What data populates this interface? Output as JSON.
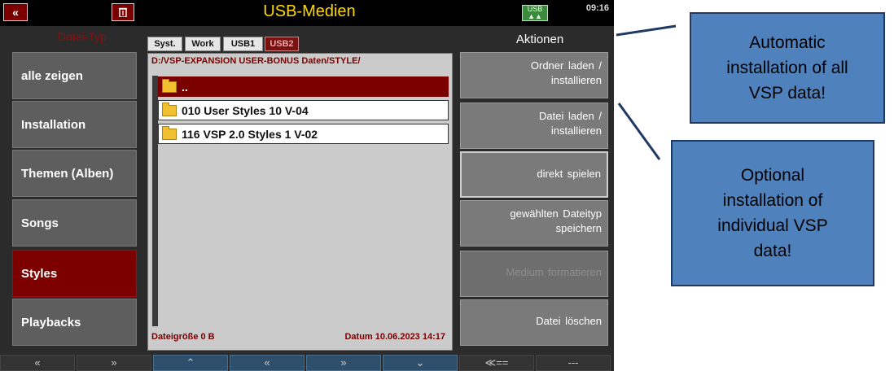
{
  "header": {
    "title": "USB-Medien",
    "time": "09:16",
    "back_icon": "double-chevron-left-icon",
    "trash_icon": "trash-icon",
    "usb_icon_label": "USB"
  },
  "left": {
    "header": "Datei-Typ",
    "items": [
      "alle zeigen",
      "Installation",
      "Themen (Alben)",
      "Songs",
      "Styles",
      "Playbacks"
    ],
    "active_index": 4
  },
  "tabs": [
    "Syst.",
    "Work",
    "USB1",
    "USB2"
  ],
  "active_tab": "USB2",
  "panel": {
    "path": "D:/VSP-EXPANSION USER-BONUS Daten/STYLE/",
    "up_label": "..",
    "files": [
      "010 User Styles 10 V-04",
      "116 VSP 2.0 Styles 1 V-02"
    ],
    "file_size": "Dateigröße 0 B",
    "date": "Datum 10.06.2023   14:17"
  },
  "actions": {
    "header": "Aktionen",
    "buttons": [
      {
        "line1": "Ordner laden /",
        "line2": "installieren"
      },
      {
        "line1": "Datei laden /",
        "line2": "installieren"
      },
      {
        "line1": "direkt spielen",
        "line2": ""
      },
      {
        "line1": "gewählten Dateityp",
        "line2": "speichern"
      },
      {
        "line1": "Medium formatieren",
        "line2": ""
      },
      {
        "line1": "Datei löschen",
        "line2": ""
      }
    ]
  },
  "bottom_nav": [
    "«",
    "»",
    "⌃",
    "«",
    "»",
    "⌄",
    "≪==",
    "---"
  ],
  "callouts": {
    "top": "Automatic\ninstallation of all\nVSP data!",
    "bottom": "Optional\ninstallation of\nindividual VSP\ndata!"
  },
  "colors": {
    "accent_red": "#7a0000",
    "title_yellow": "#ffd800",
    "callout_blue": "#4f81bd"
  }
}
